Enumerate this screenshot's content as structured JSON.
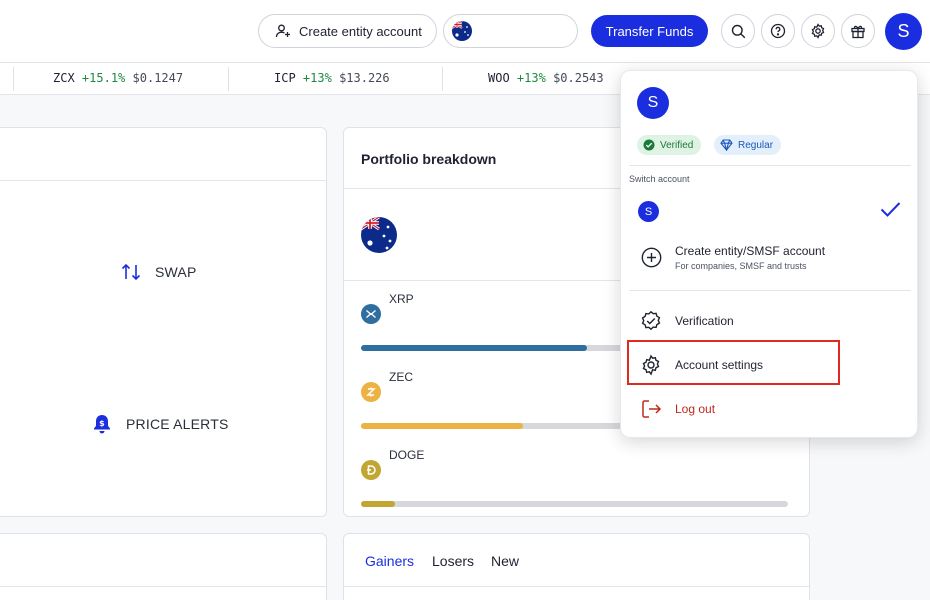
{
  "header": {
    "create_entity_label": "Create entity account",
    "transfer_label": "Transfer Funds",
    "avatar_letter": "S"
  },
  "ticker": [
    {
      "symbol": "ZCX",
      "change": "+15.1%",
      "price": "$0.1247"
    },
    {
      "symbol": "ICP",
      "change": "+13%",
      "price": "$13.226"
    },
    {
      "symbol": "WOO",
      "change": "+13%",
      "price": "$0.2543"
    }
  ],
  "actions": {
    "swap_label": "SWAP",
    "price_alerts_label": "PRICE ALERTS"
  },
  "portfolio": {
    "title": "Portfolio breakdown",
    "assets": [
      {
        "name": "XRP",
        "color": "#2f6fa0",
        "fraction": 0.53
      },
      {
        "name": "ZEC",
        "color": "#ecb244",
        "fraction": 0.38
      },
      {
        "name": "DOGE",
        "color": "#c2a633",
        "fraction": 0.08
      }
    ]
  },
  "movers": {
    "tabs": [
      "Gainers",
      "Losers",
      "New"
    ],
    "active_tab": "Gainers"
  },
  "menu": {
    "avatar_letter": "S",
    "verified_label": "Verified",
    "regular_label": "Regular",
    "switch_account_label": "Switch account",
    "current_account_letter": "S",
    "create_entity_title": "Create entity/SMSF account",
    "create_entity_sub": "For companies, SMSF and trusts",
    "verification_label": "Verification",
    "account_settings_label": "Account settings",
    "logout_label": "Log out"
  },
  "colors": {
    "primary": "#1a2ee0",
    "positive": "#1b8a3e",
    "danger": "#c0281e",
    "highlight": "#e02a1f"
  }
}
